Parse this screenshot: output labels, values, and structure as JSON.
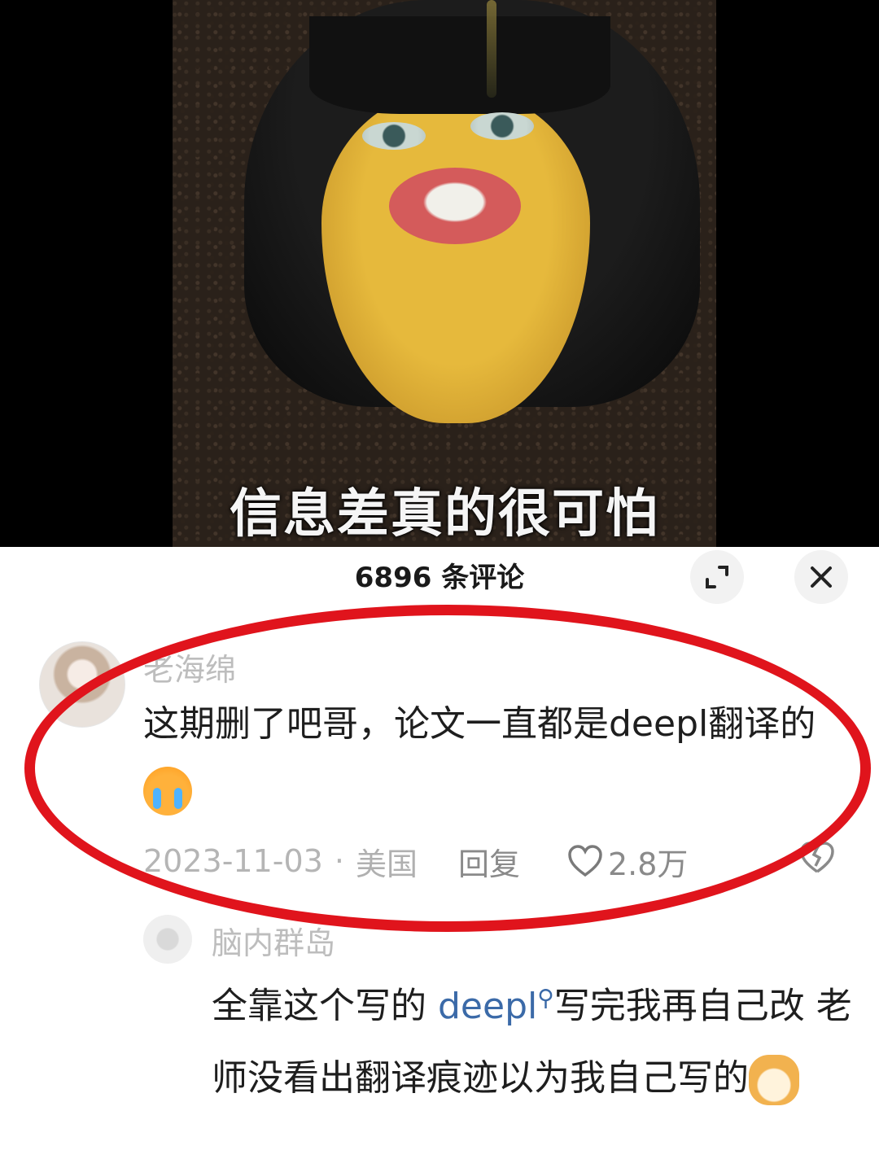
{
  "video": {
    "caption": "信息差真的很可怕"
  },
  "comments_panel": {
    "title": "6896 条评论",
    "expand_icon": "expand-icon",
    "close_icon": "close-icon"
  },
  "comments": [
    {
      "username": "老海绵",
      "text": "这期删了吧哥，论文一直都是deepl翻译的",
      "emoji": "crying-face",
      "date": "2023-11-03",
      "separator": "·",
      "location": "美国",
      "reply_label": "回复",
      "like_count": "2.8万"
    },
    {
      "username": "脑内群岛",
      "text_before_link": "全靠这个写的 ",
      "link_text": "deepl",
      "text_after_link": "写完我再自己改 老师没看出翻译痕迹以为我自己写的",
      "emoji": "dog-face"
    }
  ],
  "annotation_color": "#e0141c"
}
